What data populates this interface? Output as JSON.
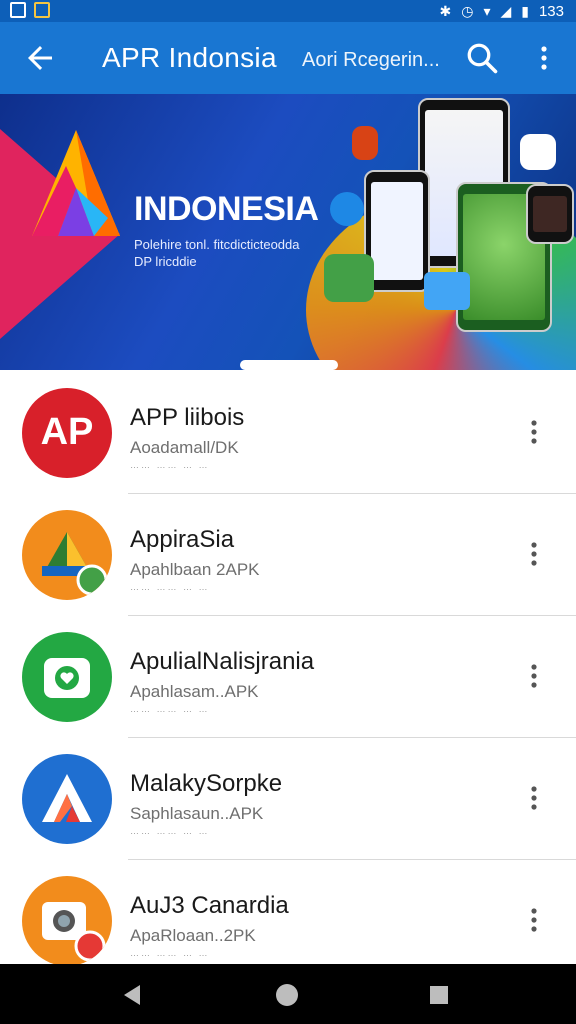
{
  "status_bar": {
    "time": "133",
    "icons": [
      "image-icon",
      "warning-icon",
      "bluetooth-icon",
      "clock-icon",
      "wifi-icon",
      "signal-icon",
      "battery-icon"
    ]
  },
  "app_bar": {
    "title": "APR Indonsia",
    "subtitle": "Aori Rcegerin...",
    "icons": [
      "back-arrow-icon",
      "search-icon",
      "more-vert-icon"
    ]
  },
  "banner": {
    "headline": "INDONESIA",
    "tagline_line1": "Polehire tonl. fitcdicticteodda",
    "tagline_line2": "DP lricddie"
  },
  "apps": [
    {
      "name": "APP liibois",
      "sub": "Aoadamall/DK",
      "meta": "…… …… … …",
      "icon": "ap-logo-icon",
      "color": "#d8202a"
    },
    {
      "name": "AppiraSia",
      "sub": "Apahlbaan 2APK",
      "meta": "…… …… … …",
      "icon": "triangle-logo-icon",
      "color": "#f28c1c"
    },
    {
      "name": "ApulialNalisjrania",
      "sub": "Apahlasam..APK",
      "meta": "…… …… … …",
      "icon": "camera-heart-icon",
      "color": "#23a843"
    },
    {
      "name": "MalakySorpke",
      "sub": "Saphlasaun..APK",
      "meta": "…… …… … …",
      "icon": "a-letter-logo-icon",
      "color": "#1f6fd1"
    },
    {
      "name": "AuJ3 Canardia",
      "sub": "ApaRloaan..2PK",
      "meta": "…… …… … …",
      "icon": "camera-icon",
      "color": "#f28c1c"
    }
  ],
  "colors": {
    "status_bar": "#0d5fb8",
    "app_bar": "#1976d2",
    "nav_bar": "#000000"
  }
}
